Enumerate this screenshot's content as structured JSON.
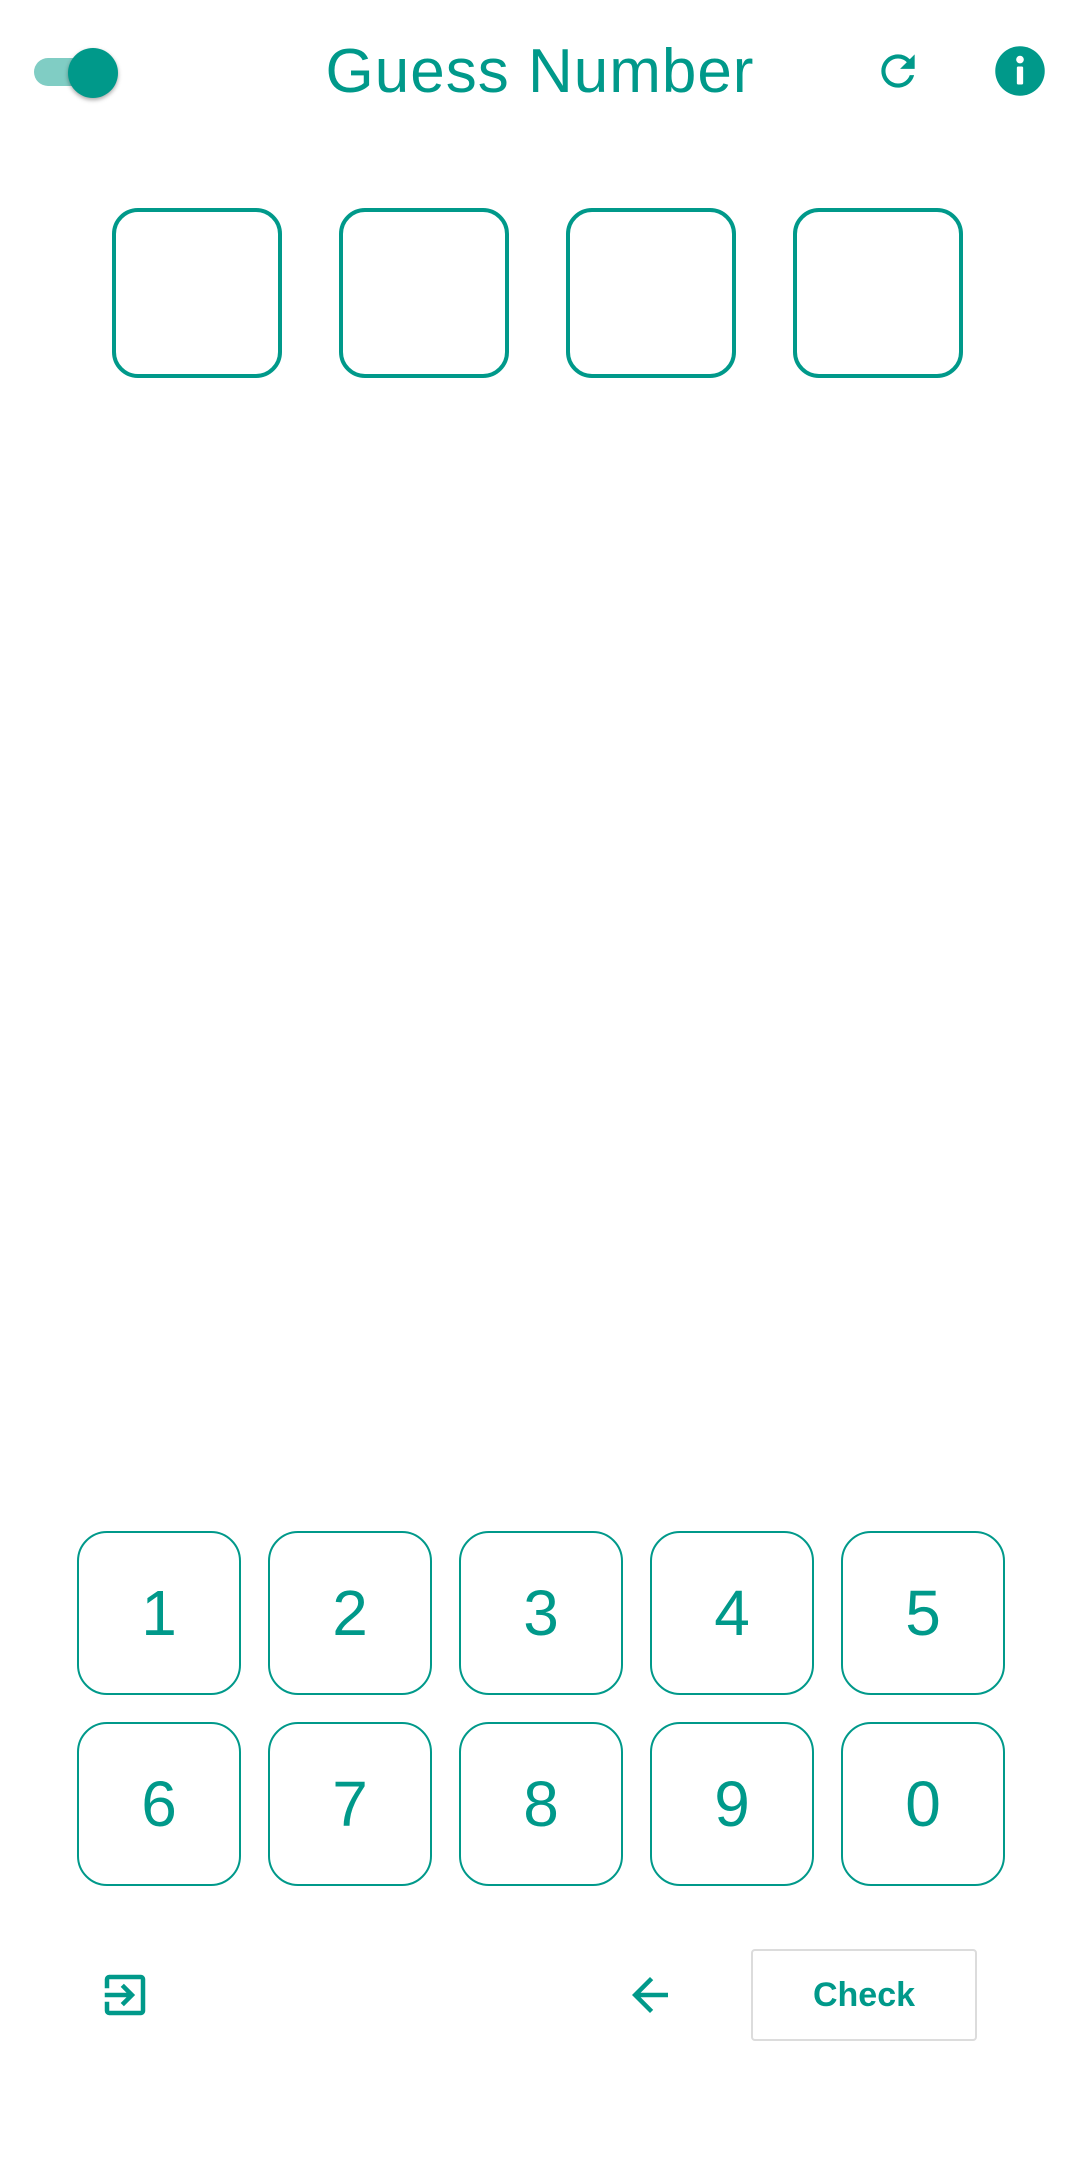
{
  "app": {
    "title": "Guess Number",
    "accent_color": "#00998a",
    "accent_light": "#80cdc4"
  },
  "header": {
    "toggle": {
      "state": "on",
      "icon": "toggle-switch-icon"
    },
    "refresh": {
      "icon": "refresh-icon"
    },
    "info": {
      "icon": "info-icon"
    }
  },
  "guess_slots": [
    "",
    "",
    "",
    ""
  ],
  "keypad": {
    "row1": [
      "1",
      "2",
      "3",
      "4",
      "5"
    ],
    "row2": [
      "6",
      "7",
      "8",
      "9",
      "0"
    ]
  },
  "footer": {
    "exit": {
      "icon": "exit-to-app-icon"
    },
    "backspace": {
      "icon": "arrow-left-icon"
    },
    "check_label": "Check"
  }
}
